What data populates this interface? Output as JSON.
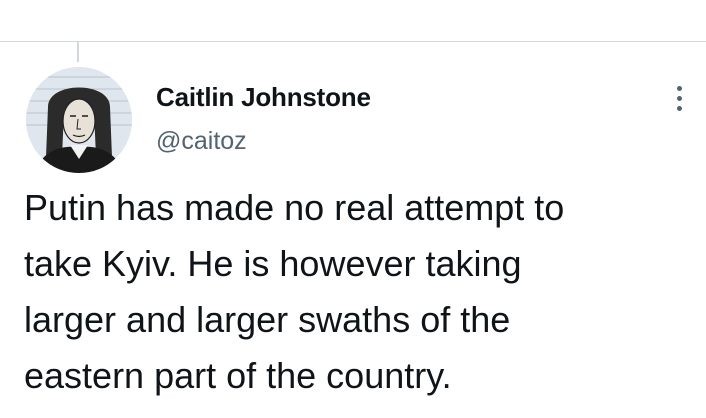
{
  "tweet": {
    "author_name": "Caitlin Johnstone",
    "author_handle": "@caitoz",
    "text_lines": [
      "Putin has made no real attempt to",
      "take Kyiv. He is however taking",
      "larger and larger swaths of the",
      "eastern part of the country."
    ]
  },
  "icons": {
    "more": "more-options-icon",
    "previous": "previous-tweet-action-icon"
  },
  "colors": {
    "text_primary": "#0f1419",
    "text_secondary": "#536471",
    "divider": "#cfd9de"
  }
}
